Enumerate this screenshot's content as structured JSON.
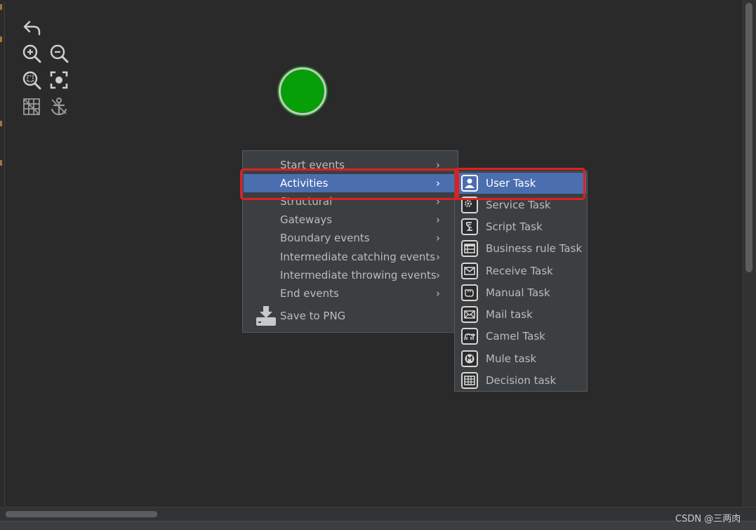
{
  "toolbar": {
    "rows": [
      [
        "undo-icon"
      ],
      [
        "zoom-in-icon",
        "zoom-out-icon"
      ],
      [
        "zoom-fit-icon",
        "center-focus-icon"
      ],
      [
        "grid-icon",
        "anchor-icon"
      ]
    ]
  },
  "diagram": {
    "start_event": {
      "type": "start-event",
      "fill": "#079f07"
    }
  },
  "context_menu": {
    "items": [
      {
        "label": "Start events",
        "has_submenu": true
      },
      {
        "label": "Activities",
        "has_submenu": true,
        "selected": true
      },
      {
        "label": "Structural",
        "has_submenu": true
      },
      {
        "label": "Gateways",
        "has_submenu": true
      },
      {
        "label": "Boundary events",
        "has_submenu": true
      },
      {
        "label": "Intermediate catching events",
        "has_submenu": true
      },
      {
        "label": "Intermediate throwing events",
        "has_submenu": true
      },
      {
        "label": "End events",
        "has_submenu": true
      }
    ],
    "save": {
      "label": "Save to PNG",
      "icon": "download-drive-icon"
    }
  },
  "activities_submenu": {
    "items": [
      {
        "label": "User Task",
        "icon": "user-icon",
        "selected": true
      },
      {
        "label": "Service Task",
        "icon": "gear-icon"
      },
      {
        "label": "Script Task",
        "icon": "script-icon"
      },
      {
        "label": "Business rule Task",
        "icon": "table-icon"
      },
      {
        "label": "Receive Task",
        "icon": "envelope-icon"
      },
      {
        "label": "Manual Task",
        "icon": "hand-icon"
      },
      {
        "label": "Mail task",
        "icon": "mail-icon"
      },
      {
        "label": "Camel Task",
        "icon": "camel-icon"
      },
      {
        "label": "Mule task",
        "icon": "mule-icon"
      },
      {
        "label": "Decision task",
        "icon": "grid-table-icon"
      }
    ]
  },
  "watermark": {
    "text": "CSDN @三两肉"
  },
  "colors": {
    "canvas_bg": "#2a2a2a",
    "menu_bg": "#3c3f41",
    "selection": "#4b6eaf",
    "highlight": "#e0201f",
    "start_event": "#079f07"
  }
}
